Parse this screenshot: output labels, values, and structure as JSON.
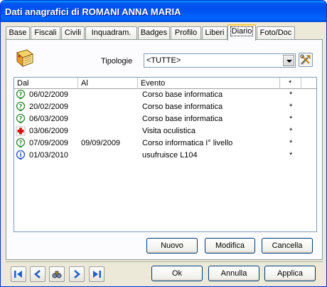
{
  "window": {
    "title": "Dati anagrafici di ROMANI ANNA MARIA"
  },
  "tabs": [
    {
      "label": "Base"
    },
    {
      "label": "Fiscali"
    },
    {
      "label": "Civili"
    },
    {
      "label": "Inquadram."
    },
    {
      "label": "Badges"
    },
    {
      "label": "Profilo"
    },
    {
      "label": "Liberi"
    },
    {
      "label": "Diario"
    },
    {
      "label": "Foto/Doc"
    }
  ],
  "filter": {
    "label": "Tipologie",
    "value": "<TUTTE>"
  },
  "table": {
    "headers": {
      "dal": "Dal",
      "al": "Al",
      "evento": "Evento",
      "flag": "*"
    },
    "rows": [
      {
        "icon": "question-pin-icon",
        "dal": "06/02/2009",
        "al": "",
        "evento": "Corso base informatica",
        "flag": "*"
      },
      {
        "icon": "question-pin-icon",
        "dal": "20/02/2009",
        "al": "",
        "evento": "Corso base informatica",
        "flag": "*"
      },
      {
        "icon": "question-pin-icon",
        "dal": "06/03/2009",
        "al": "",
        "evento": "Corso base informatica",
        "flag": "*"
      },
      {
        "icon": "red-cross-icon",
        "dal": "03/06/2009",
        "al": "",
        "evento": "Visita oculistica",
        "flag": "*"
      },
      {
        "icon": "question-pin-icon",
        "dal": "07/09/2009",
        "al": "09/09/2009",
        "evento": "Corso informatica I° livello",
        "flag": "*"
      },
      {
        "icon": "info-pin-icon",
        "dal": "01/03/2010",
        "al": "",
        "evento": "usufruisce L104",
        "flag": "*"
      }
    ]
  },
  "actions": {
    "nuovo": "Nuovo",
    "modifica": "Modifica",
    "cancella": "Cancella"
  },
  "footer": {
    "ok": "Ok",
    "annulla": "Annulla",
    "applica": "Applica"
  }
}
